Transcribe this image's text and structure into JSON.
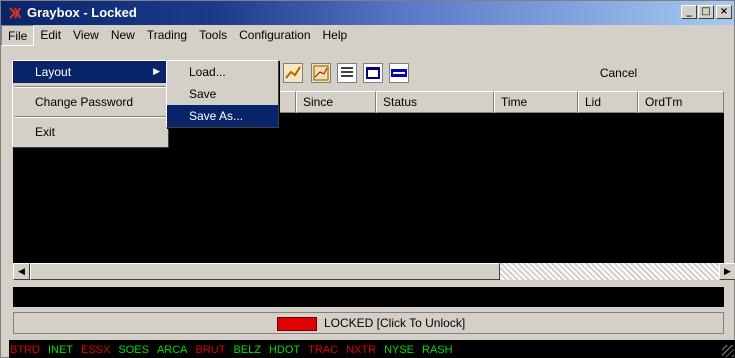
{
  "window": {
    "title": "Graybox - Locked",
    "min_label": "_",
    "max_label": "□",
    "close_label": "×"
  },
  "menubar": [
    "File",
    "Edit",
    "View",
    "New",
    "Trading",
    "Tools",
    "Configuration",
    "Help"
  ],
  "file_menu": {
    "layout": "Layout",
    "change_password": "Change Password",
    "exit": "Exit"
  },
  "layout_menu": {
    "load": "Load...",
    "save": "Save",
    "save_as": "Save As..."
  },
  "toolbar": {
    "cancel_label": "Cancel"
  },
  "grid": {
    "columns": [
      "Since",
      "Status",
      "Time",
      "Lid",
      "OrdTm"
    ]
  },
  "lock": {
    "label": "LOCKED [Click To Unlock]",
    "color": "#e00000"
  },
  "exchanges": [
    {
      "name": "BTRD",
      "color": "#e00000"
    },
    {
      "name": "INET",
      "color": "#00e000"
    },
    {
      "name": "ESSX",
      "color": "#e00000"
    },
    {
      "name": "SOES",
      "color": "#00e000"
    },
    {
      "name": "ARCA",
      "color": "#00e000"
    },
    {
      "name": "BRUT",
      "color": "#e00000"
    },
    {
      "name": "BELZ",
      "color": "#00e000"
    },
    {
      "name": "HDOT",
      "color": "#00e000"
    },
    {
      "name": "TRAC",
      "color": "#e00000"
    },
    {
      "name": "NXTR",
      "color": "#e00000"
    },
    {
      "name": "NYSE",
      "color": "#00e000"
    },
    {
      "name": "RASH",
      "color": "#00e000"
    }
  ]
}
